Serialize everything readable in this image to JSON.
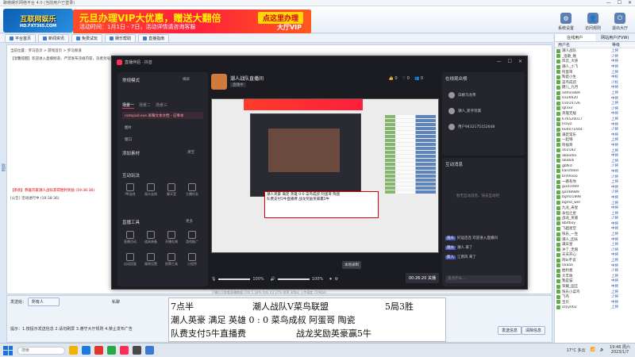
{
  "titlebar": {
    "text": "聊斋娱乐网络平台 4.0 (当前用户已登录)",
    "min": "—",
    "max": "☐",
    "close": "✕"
  },
  "logo": {
    "main": "互联网娱乐",
    "url": "HD.FXT365.COM"
  },
  "banner": {
    "line1": "元旦办理VIP大优惠，赠送大翻倍",
    "line2": "活动时间：1月1日 - 7日，活动详情请咨询客服",
    "cta": "点这里办理",
    "cta2": "大厅VIP"
  },
  "top_tools": [
    {
      "label": "系统设置",
      "icon": "⚙"
    },
    {
      "label": "访问规则",
      "icon": "👤"
    },
    {
      "label": "退出大厅",
      "icon": "⏻"
    }
  ],
  "tabs": [
    "平台首页",
    "新闻资讯",
    "免费试玩",
    "娱乐帮助",
    "直播指南"
  ],
  "chat_lines": [
    {
      "text": "当前位置：罗马首页 > 游戏首页 > 罗马频道",
      "red": false
    },
    {
      "text": "【温馨提醒】欢迎进入直播频道，严禁发布违规内容，违者封号处理",
      "red": false
    },
    {
      "text": "【系统】恭喜玩家潮人战队获得胜利奖励 (19:36:36)",
      "red": true
    },
    {
      "text": "[公告] 活动进行中 (19:38:36)",
      "red": false
    }
  ],
  "bottom": {
    "speak_label": "发送给：",
    "speak_to": "所有人",
    "private": "私聊",
    "send": "发送信息",
    "clear": "清除信息",
    "tip": "提示：1.按提示发送信息 2.请勿刷屏 3.遵守大厅规则 4.禁止发布广告"
  },
  "right_panel": {
    "tabs": [
      "在线用户",
      "网站用户(FVW)"
    ],
    "header": [
      "用户名",
      "等级"
    ],
    "users": [
      {
        "name": "潮人战队",
        "lv": "上将"
      },
      {
        "name": "_渔歌_晚",
        "lv": "少将"
      },
      {
        "name": "风云_大侠",
        "lv": "中将"
      },
      {
        "name": "潮人_小飞",
        "lv": "中将"
      },
      {
        "name": "阿蛋哥",
        "lv": "上将"
      },
      {
        "name": "陶瓷小生",
        "lv": "中校"
      },
      {
        "name": "菜鸟成叔",
        "lv": "少校"
      },
      {
        "name": "健儿_九月",
        "lv": "中将"
      },
      {
        "name": "admin889",
        "lv": "上将"
      },
      {
        "name": "0326620",
        "lv": "中将"
      },
      {
        "name": "03014726",
        "lv": "上将"
      },
      {
        "name": "lgl3xx",
        "lv": "少将"
      },
      {
        "name": "英雄无敌",
        "lv": "中将"
      },
      {
        "name": "676520017",
        "lv": "上将"
      },
      {
        "name": "lisxyz",
        "lv": "中将"
      },
      {
        "name": "604071444",
        "lv": "少将"
      },
      {
        "name": "满足常乐",
        "lv": "中将"
      },
      {
        "name": "一起嗨",
        "lv": "上将"
      },
      {
        "name": "阿福哥",
        "lv": "中将"
      },
      {
        "name": "a02182",
        "lv": "上将"
      },
      {
        "name": "aboodia",
        "lv": "中将"
      },
      {
        "name": "abobdi",
        "lv": "上将"
      },
      {
        "name": "gbfkd",
        "lv": "少将"
      },
      {
        "name": "kanstebd",
        "lv": "中将"
      },
      {
        "name": "bnhhooo",
        "lv": "少将"
      },
      {
        "name": "一路有你",
        "lv": "上将"
      },
      {
        "name": "gixd1069",
        "lv": "中将"
      },
      {
        "name": "gard8989",
        "lv": "少将"
      },
      {
        "name": "bgmz1898",
        "lv": "中将"
      },
      {
        "name": "bgmo_wer",
        "lv": "上将"
      },
      {
        "name": "九龙_寿星",
        "lv": "中将"
      },
      {
        "name": "永恒之星",
        "lv": "上将"
      },
      {
        "name": "战龙_英豪",
        "lv": "少将"
      },
      {
        "name": "8bitboy",
        "lv": "中将"
      },
      {
        "name": "飞越星空",
        "lv": "中将"
      },
      {
        "name": "快乐_一生",
        "lv": "上将"
      },
      {
        "name": "潮人_团长",
        "lv": "中将"
      },
      {
        "name": "满天星",
        "lv": "上将"
      },
      {
        "name": "冲了_无限",
        "lv": "少将"
      },
      {
        "name": "天天开心",
        "lv": "中将"
      },
      {
        "name": "阿bi不说",
        "lv": "上将"
      },
      {
        "name": "0xaaa",
        "lv": "中将"
      },
      {
        "name": "胜利者",
        "lv": "少将"
      },
      {
        "name": "大丰收",
        "lv": "上将"
      },
      {
        "name": "我是猫",
        "lv": "中将"
      },
      {
        "name": "荣耀_国王",
        "lv": "中将"
      },
      {
        "name": "快乐小菜鸟",
        "lv": "上将"
      },
      {
        "name": "飞鸟",
        "lv": "少将"
      },
      {
        "name": "宝贝",
        "lv": "中将"
      },
      {
        "name": "zzyy002",
        "lv": "上将"
      }
    ]
  },
  "stream_app": {
    "title": "直播伴侣 · 抖音",
    "win_min": "—",
    "win_max": "☐",
    "win_close": "✕",
    "mode_label": "常规模式",
    "landscape": "横屏",
    "scene_tabs": [
      "场景一",
      "场景二",
      "场景三"
    ],
    "sources": [
      {
        "label": "notepad.exe 屏幕文本文档 - 记事本",
        "sel": true
      },
      {
        "label": "图片",
        "sel": false
      },
      {
        "label": "窗口",
        "sel": false
      }
    ],
    "add_source": "添加素材",
    "clear": "清空",
    "interact_title": "互动玩法",
    "interact_items": [
      "PK连线",
      "观众连线",
      "聊天室",
      "主播任务"
    ],
    "tools_title": "直播工具",
    "more": "更多",
    "tools": [
      "直播活动",
      "道具装备",
      "开播礼物",
      "游戏推广",
      "自动回复",
      "福袋设置",
      "投票工具",
      "小程序"
    ],
    "stream_name": "潮人战队直播间",
    "stream_tag": "直播中",
    "stats": [
      "👍 0",
      "♡ 0",
      "👥 0"
    ],
    "preview_caption_l1": "潮人英豪  满足  英雄  0:0  菜鸟成叔  阿蛋哥  陶瓷",
    "preview_caption_l2": "队费支付5牛直播费          战龙奖励英豪赢5牛",
    "mic_pct": "100%",
    "spk_pct": "100%",
    "timer": "00:26:20 关播",
    "tooltip": "本地录制",
    "footer": "下播后可查看直播数据   CPU 5.18%   内存 43.37%   帧率 30fps   上传速度 729kb/s",
    "viewers_title": "在线观众榜",
    "viewers": [
      "白桃乌龙茶",
      "潮人_新手玩家",
      "用户9432175152648"
    ],
    "msgs_title": "互动消息",
    "empty_hint": "暂无互动消息，快去互动吧",
    "msgs": [
      {
        "tag": "观众",
        "text": "好运连连 欢迎进入直播间"
      },
      {
        "tag": "观众",
        "text": "潮人 来了"
      },
      {
        "tag": "新人",
        "text": "江南风 来了"
      }
    ],
    "input_hint": "说点什么..."
  },
  "caption": {
    "l1a": "7点半",
    "l1b": "潮人战队V菜鸟联盟",
    "l1c": "5局3胜",
    "l2": "潮人英豪  满足  英雄   0  :  0  菜鸟成叔  阿蛋哥  陶瓷",
    "l3a": "队费支付5牛直播费",
    "l3b": "战龙奖励英豪赢5牛"
  },
  "taskbar": {
    "search": "搜索",
    "weather": "17°C 多云",
    "time": "19:46 周六",
    "date": "2023/1/7"
  }
}
